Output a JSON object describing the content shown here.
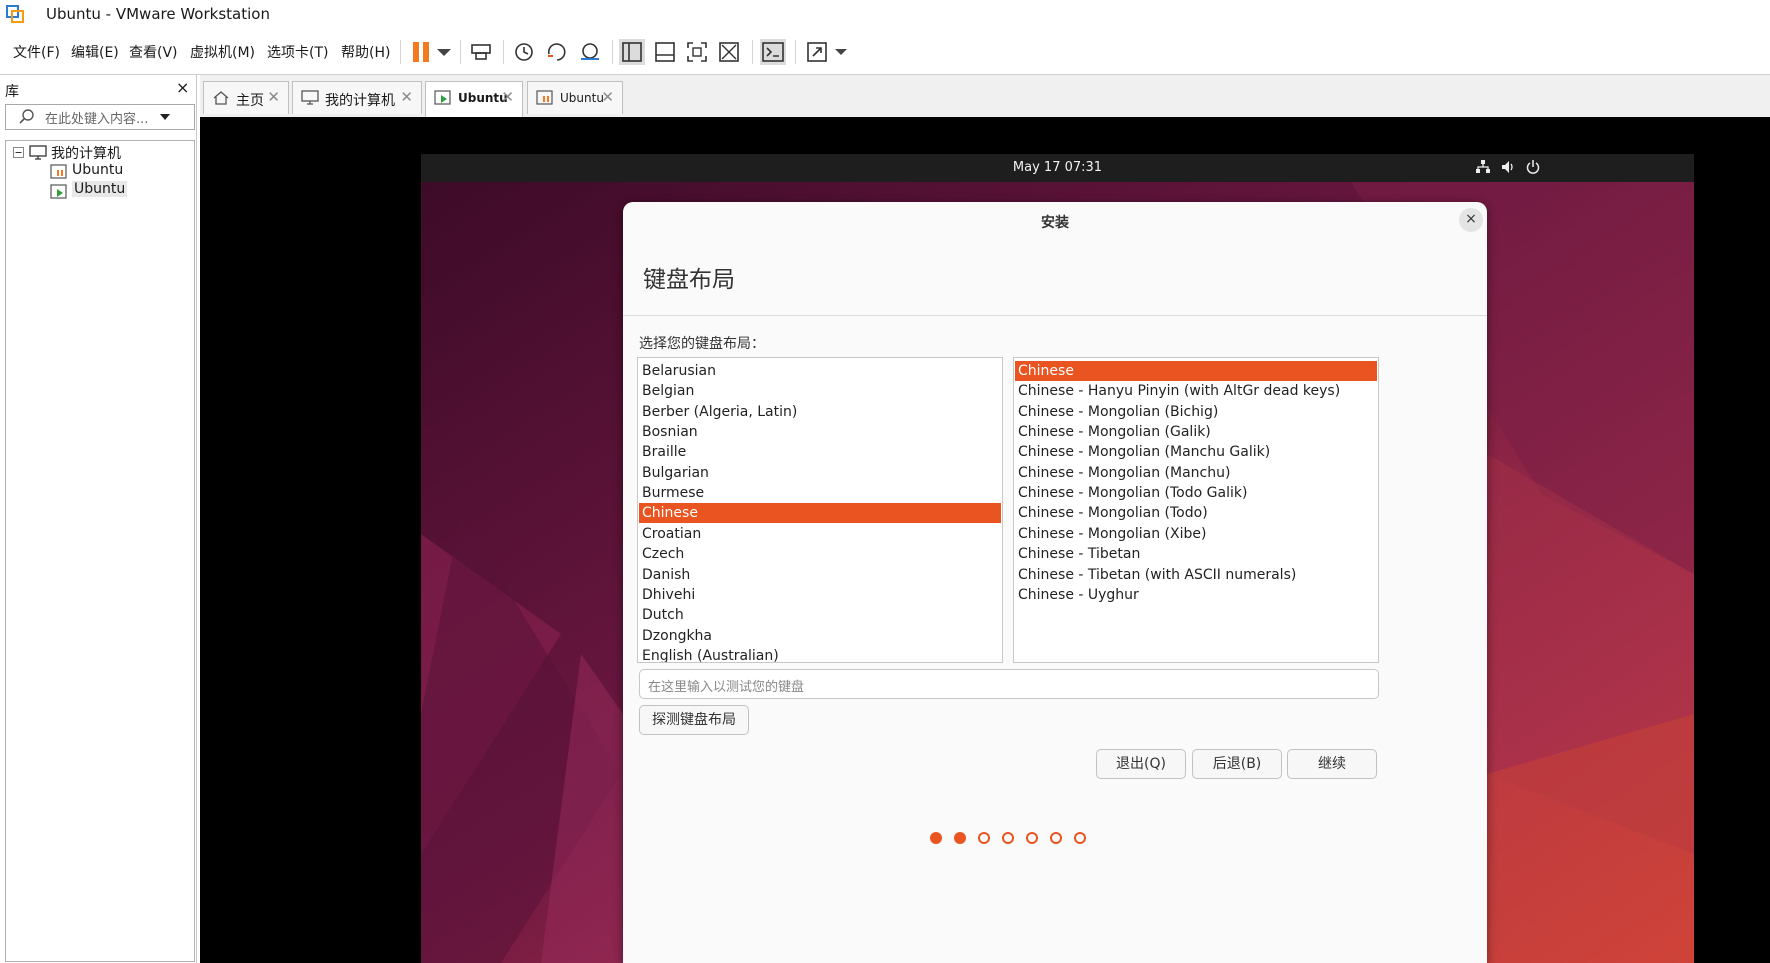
{
  "window": {
    "title": "Ubuntu - VMware Workstation"
  },
  "menu": [
    "文件(F)",
    "编辑(E)",
    "查看(V)",
    "虚拟机(M)",
    "选项卡(T)",
    "帮助(H)"
  ],
  "toolbar_icons": [
    "pause-icon",
    "dropdown-icon",
    "send-ctrl-alt-del-icon",
    "snapshot-icon",
    "revert-snapshot-icon",
    "snapshot-manager-icon",
    "library-view-icon",
    "thumbnail-view-icon",
    "fullscreen-icon",
    "unity-icon",
    "console-icon",
    "stretch-icon",
    "dropdown-icon"
  ],
  "library": {
    "title": "库",
    "close": "×",
    "search_placeholder": "在此处键入内容...",
    "tree": {
      "root": "我的计算机",
      "children": [
        "Ubuntu",
        "Ubuntu"
      ]
    }
  },
  "tabs": [
    {
      "label": "主页",
      "active": false
    },
    {
      "label": "我的计算机",
      "active": false
    },
    {
      "label": "Ubuntu",
      "active": true
    },
    {
      "label": "Ubuntu",
      "active": false
    }
  ],
  "guest": {
    "clock": "May 17  07:31",
    "status_icons": [
      "network-icon",
      "volume-icon",
      "power-icon"
    ]
  },
  "installer": {
    "title": "安装",
    "close": "×",
    "heading": "键盘布局",
    "prompt": "选择您的键盘布局：",
    "layouts": [
      "Belarusian",
      "Belgian",
      "Berber (Algeria, Latin)",
      "Bosnian",
      "Braille",
      "Bulgarian",
      "Burmese",
      "Chinese",
      "Croatian",
      "Czech",
      "Danish",
      "Dhivehi",
      "Dutch",
      "Dzongkha",
      "English (Australian)"
    ],
    "selected_layout": "Chinese",
    "variants": [
      "Chinese",
      "Chinese - Hanyu Pinyin (with AltGr dead keys)",
      "Chinese - Mongolian (Bichig)",
      "Chinese - Mongolian (Galik)",
      "Chinese - Mongolian (Manchu Galik)",
      "Chinese - Mongolian (Manchu)",
      "Chinese - Mongolian (Todo Galik)",
      "Chinese - Mongolian (Todo)",
      "Chinese - Mongolian (Xibe)",
      "Chinese - Tibetan",
      "Chinese - Tibetan (with ASCII numerals)",
      "Chinese - Uyghur"
    ],
    "selected_variant": "Chinese",
    "test_placeholder": "在这里输入以测试您的键盘",
    "detect_button": "探测键盘布局",
    "quit_button": "退出(Q)",
    "back_button": "后退(B)",
    "continue_button": "继续",
    "steps_total": 7,
    "steps_done": 2
  },
  "colors": {
    "accent": "#e95420",
    "vmware_pause": "#f47a20"
  }
}
